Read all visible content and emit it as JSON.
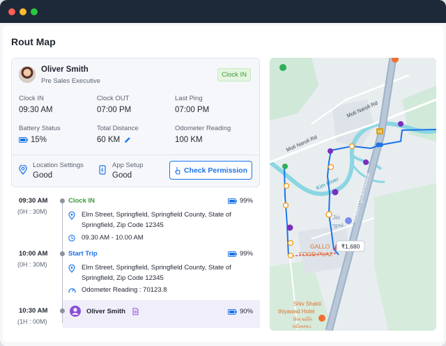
{
  "window": {
    "title": "Rout Map"
  },
  "employee": {
    "name": "Oliver Smith",
    "role": "Pre Sales Executive",
    "status": "Clock IN"
  },
  "stats": {
    "clock_in": {
      "label": "Clock IN",
      "value": "09:30 AM"
    },
    "clock_out": {
      "label": "Clock OUT",
      "value": "07:00 PM"
    },
    "last_ping": {
      "label": "Last Ping",
      "value": "07:00 PM"
    },
    "battery": {
      "label": "Battery Status",
      "value": "15%"
    },
    "distance": {
      "label": "Total Distance",
      "value": "60 KM"
    },
    "odometer": {
      "label": "Odometer Reading",
      "value": "100 KM"
    }
  },
  "settings": {
    "location": {
      "label": "Location Settings",
      "value": "Good"
    },
    "app": {
      "label": "App Setup",
      "value": "Good"
    },
    "check_button": "Check Permission"
  },
  "timeline": [
    {
      "time": "09:30 AM",
      "duration": "(0H : 30M)",
      "event": "Clock IN",
      "battery": "99%",
      "address_line1": "Elm Street, Springfield, Springfield County, State of",
      "address_line2": "Springfield, Zip Code 12345",
      "detail": "09.30 AM - 10.00 AM"
    },
    {
      "time": "10:00 AM",
      "duration": "(0H : 30M)",
      "event": "Start Trip",
      "battery": "99%",
      "address_line1": "Elm Street, Springfield, Springfield County, State of",
      "address_line2": "Springfield, Zip Code 12345",
      "detail": "Odometer Reading : 70123.8"
    },
    {
      "time": "10:30 AM",
      "duration": "(1H : 00M)",
      "event": "Oliver Smith",
      "battery": "90%"
    }
  ],
  "map": {
    "labels": {
      "road1": "Moti Naroli Rd",
      "road2": "Moti Naroli Rd",
      "highway": "Golden Quadrilateral",
      "river": "Kim River",
      "poi_jio": "Jio",
      "poi_jio_local": "જીઓ",
      "poi_gallo_1": "GALLO",
      "poi_gallo_2": "FOOD PLAZ",
      "poi_shiv_1": "Shiv Shakti",
      "poi_shiv_2": "thiyawad Hotel",
      "poi_shiv_3": "શિવ શક્તિ",
      "poi_shiv_4": "કાઠિયાવાડ",
      "shield": "48",
      "price_tag": "₹1,680"
    }
  },
  "colors": {
    "accent_blue": "#1a73e8",
    "clock_in_green": "#3d9a3a",
    "start_trip_blue": "#1a73e8",
    "route_purple": "#7b2fbf",
    "river": "#7fd3e0"
  }
}
